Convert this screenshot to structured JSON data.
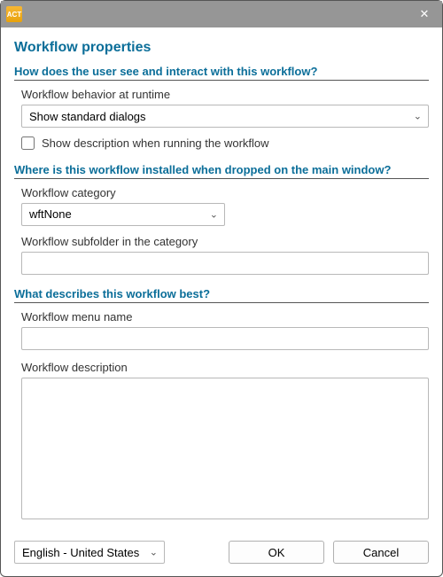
{
  "titlebar": {
    "app_icon_label": "ACT",
    "close_glyph": "✕"
  },
  "dialog": {
    "title": "Workflow properties"
  },
  "section_interaction": {
    "header": "How does the user see and interact with this workflow?",
    "behavior_label": "Workflow behavior at runtime",
    "behavior_value": "Show standard dialogs",
    "show_description_label": "Show description when running the workflow",
    "show_description_checked": false
  },
  "section_install": {
    "header": "Where is this workflow installed when dropped on the main window?",
    "category_label": "Workflow category",
    "category_value": "wftNone",
    "subfolder_label": "Workflow subfolder in the category",
    "subfolder_value": ""
  },
  "section_describe": {
    "header": "What describes this workflow best?",
    "menu_name_label": "Workflow menu name",
    "menu_name_value": "",
    "description_label": "Workflow description",
    "description_value": ""
  },
  "footer": {
    "language_value": "English - United States",
    "ok_label": "OK",
    "cancel_label": "Cancel"
  }
}
